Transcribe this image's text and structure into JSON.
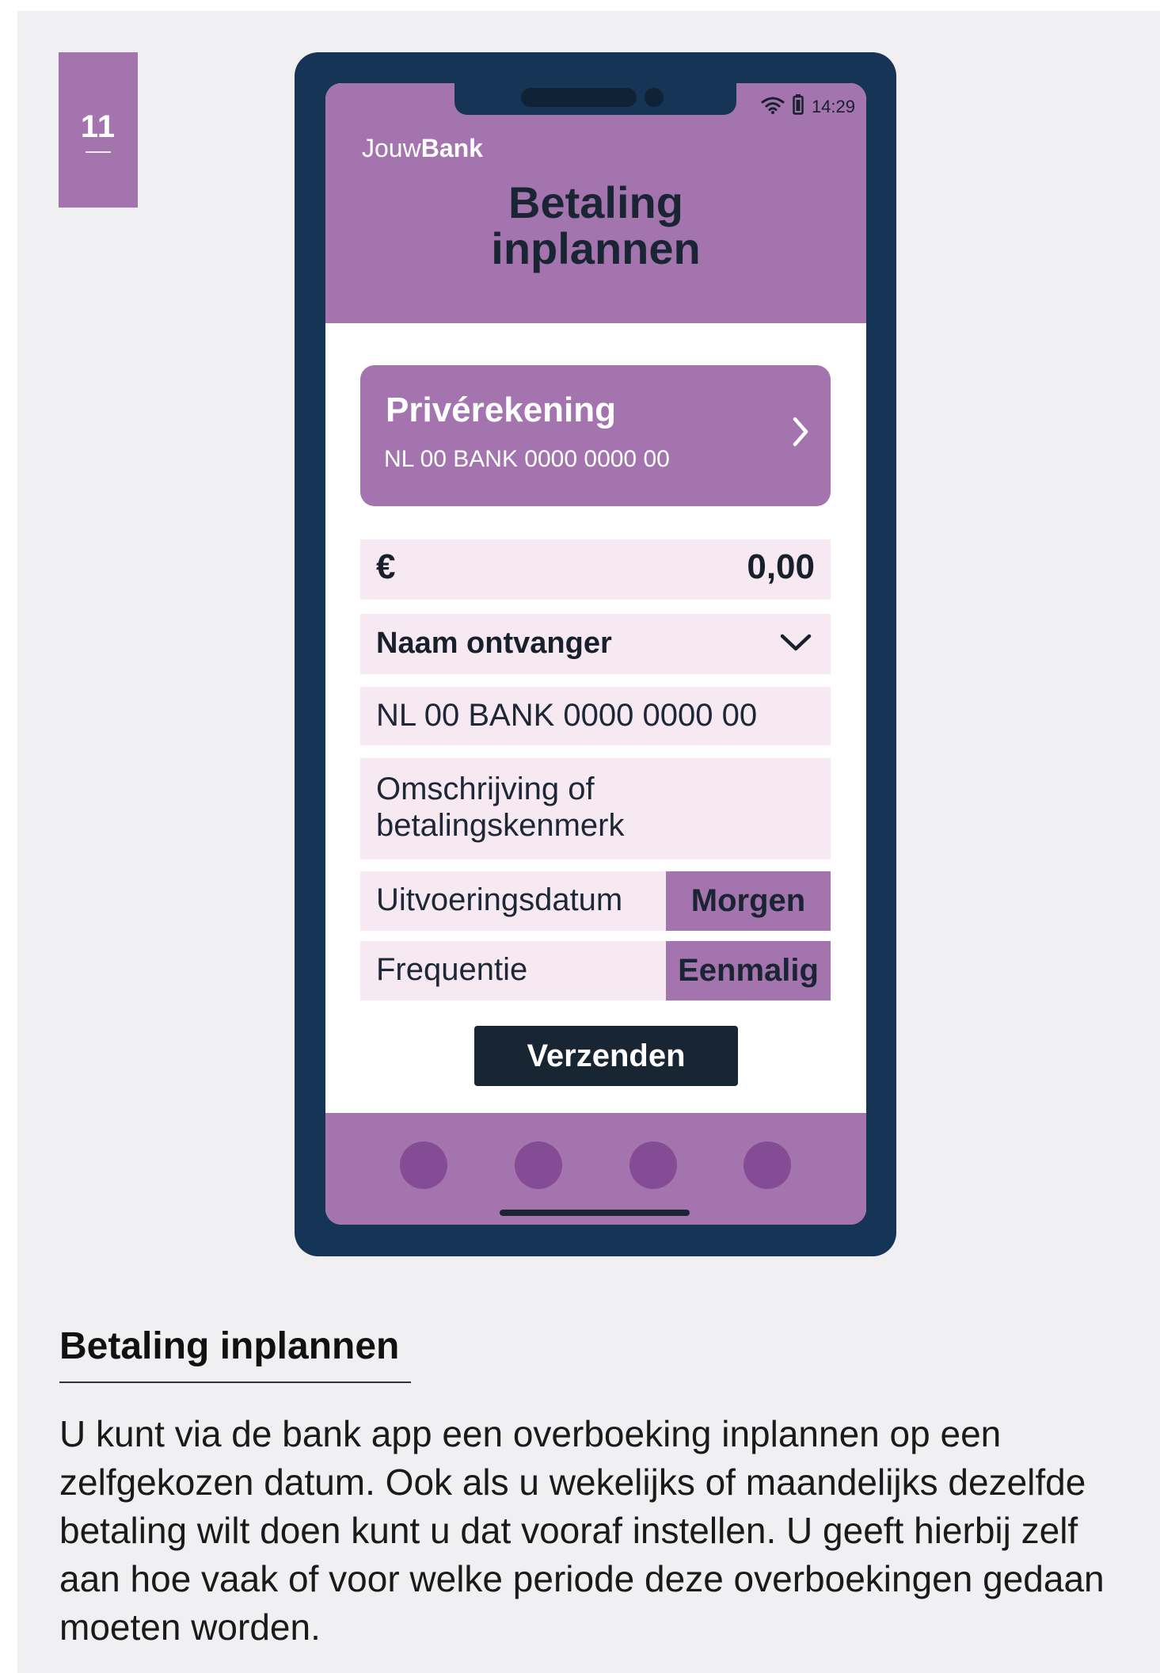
{
  "page_number": "11",
  "phone": {
    "status_time": "14:29",
    "brand_prefix": "Jouw",
    "brand_suffix": "Bank",
    "title": "Betaling inplannen",
    "account": {
      "name": "Privérekening",
      "iban": "NL 00 BANK 0000 0000 00"
    },
    "amount": {
      "currency_symbol": "€",
      "value": "0,00"
    },
    "recipient_placeholder": "Naam ontvanger",
    "recipient_iban": "NL 00 BANK 0000 0000 00",
    "description_placeholder": "Omschrijving of betalingskenmerk",
    "execution_date": {
      "label": "Uitvoeringsdatum",
      "value": "Morgen"
    },
    "frequency": {
      "label": "Frequentie",
      "value": "Eenmalig"
    },
    "send_label": "Verzenden",
    "icons": [
      "wifi-icon",
      "battery-icon",
      "chevron-right-icon",
      "chevron-down-icon"
    ],
    "nav_items": [
      "nav-dot-1",
      "nav-dot-2",
      "nav-dot-3",
      "nav-dot-4"
    ]
  },
  "section": {
    "title": "Betaling inplannen",
    "body": "U kunt via de bank app een overboeking inplannen op een zelfgekozen datum. Ook als u wekelijks of maandelijks dezelfde betaling wilt doen kunt u dat vooraf instellen. U geeft hierbij zelf aan hoe vaak of voor welke periode deze overboekingen gedaan moeten worden."
  },
  "colors": {
    "accent_purple": "#a474ae",
    "field_background": "#f6e9f2",
    "phone_frame": "#163556",
    "nav_dot": "#834c94",
    "button_dark": "#182533"
  }
}
